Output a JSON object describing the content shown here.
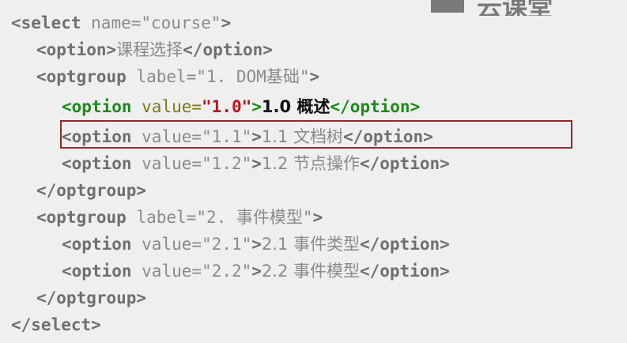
{
  "logo": {
    "text": "云课堂"
  },
  "lines": [
    {
      "indent": 0,
      "highlight": false,
      "parts": [
        {
          "t": "tag",
          "v": "<select"
        },
        {
          "t": "attr",
          "v": " name="
        },
        {
          "t": "str",
          "v": "\"course\""
        },
        {
          "t": "tag",
          "v": ">"
        }
      ]
    },
    {
      "indent": 1,
      "highlight": false,
      "parts": [
        {
          "t": "tag",
          "v": "<option>"
        },
        {
          "t": "txt",
          "v": "课程选择"
        },
        {
          "t": "tag",
          "v": "</option>"
        }
      ]
    },
    {
      "indent": 1,
      "highlight": false,
      "parts": [
        {
          "t": "tag",
          "v": "<optgroup"
        },
        {
          "t": "attr",
          "v": " label="
        },
        {
          "t": "str",
          "v": "\"1. DOM基础\""
        },
        {
          "t": "tag",
          "v": ">"
        }
      ]
    },
    {
      "indent": 2,
      "highlight": true,
      "parts": [
        {
          "t": "tag",
          "v": "<option"
        },
        {
          "t": "attr",
          "v": " value="
        },
        {
          "t": "str",
          "v": "\"1.0\""
        },
        {
          "t": "tag",
          "v": ">"
        },
        {
          "t": "txt",
          "v": "1.0 概述"
        },
        {
          "t": "tag",
          "v": "</option>"
        }
      ]
    },
    {
      "indent": 2,
      "highlight": false,
      "parts": [
        {
          "t": "tag",
          "v": "<option"
        },
        {
          "t": "attr",
          "v": " value="
        },
        {
          "t": "str",
          "v": "\"1.1\""
        },
        {
          "t": "tag",
          "v": ">"
        },
        {
          "t": "txt",
          "v": "1.1 文档树"
        },
        {
          "t": "tag",
          "v": "</option>"
        }
      ]
    },
    {
      "indent": 2,
      "highlight": false,
      "parts": [
        {
          "t": "tag",
          "v": "<option"
        },
        {
          "t": "attr",
          "v": " value="
        },
        {
          "t": "str",
          "v": "\"1.2\""
        },
        {
          "t": "tag",
          "v": ">"
        },
        {
          "t": "txt",
          "v": "1.2 节点操作"
        },
        {
          "t": "tag",
          "v": "</option>"
        }
      ]
    },
    {
      "indent": 1,
      "highlight": false,
      "parts": [
        {
          "t": "tag",
          "v": "</optgroup>"
        }
      ]
    },
    {
      "indent": 1,
      "highlight": false,
      "parts": [
        {
          "t": "tag",
          "v": "<optgroup"
        },
        {
          "t": "attr",
          "v": " label="
        },
        {
          "t": "str",
          "v": "\"2. 事件模型\""
        },
        {
          "t": "tag",
          "v": ">"
        }
      ]
    },
    {
      "indent": 2,
      "highlight": false,
      "parts": [
        {
          "t": "tag",
          "v": "<option"
        },
        {
          "t": "attr",
          "v": " value="
        },
        {
          "t": "str",
          "v": "\"2.1\""
        },
        {
          "t": "tag",
          "v": ">"
        },
        {
          "t": "txt",
          "v": "2.1 事件类型"
        },
        {
          "t": "tag",
          "v": "</option>"
        }
      ]
    },
    {
      "indent": 2,
      "highlight": false,
      "parts": [
        {
          "t": "tag",
          "v": "<option"
        },
        {
          "t": "attr",
          "v": " value="
        },
        {
          "t": "str",
          "v": "\"2.2\""
        },
        {
          "t": "tag",
          "v": ">"
        },
        {
          "t": "txt",
          "v": "2.2 事件模型"
        },
        {
          "t": "tag",
          "v": "</option>"
        }
      ]
    },
    {
      "indent": 1,
      "highlight": false,
      "parts": [
        {
          "t": "tag",
          "v": "</optgroup>"
        }
      ]
    },
    {
      "indent": 0,
      "highlight": false,
      "parts": [
        {
          "t": "tag",
          "v": "</select>"
        }
      ]
    }
  ]
}
